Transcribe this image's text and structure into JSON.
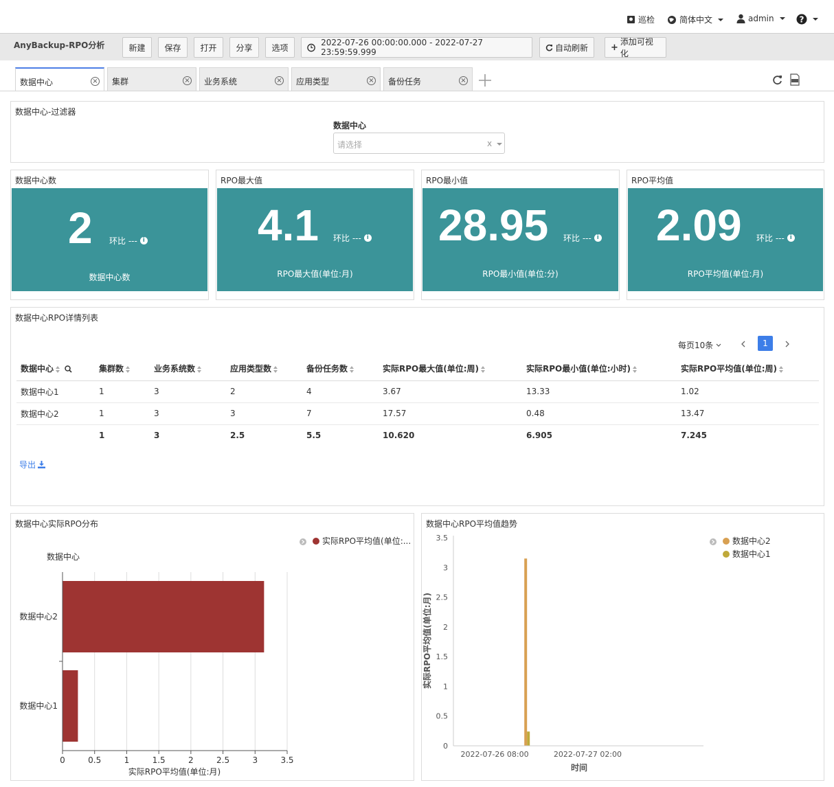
{
  "topbar": {
    "inspect_label": "巡检",
    "language_label": "简体中文",
    "user_label": "admin"
  },
  "toolbar": {
    "app_title": "AnyBackup-RPO分析",
    "new_label": "新建",
    "save_label": "保存",
    "open_label": "打开",
    "share_label": "分享",
    "options_label": "选项",
    "time_range": "2022-07-26 00:00:00.000 - 2022-07-27 23:59:59.999",
    "auto_refresh_label": "自动刷新",
    "add_visual_label": "添加可视化"
  },
  "tabs": [
    {
      "label": "数据中心"
    },
    {
      "label": "集群"
    },
    {
      "label": "业务系统"
    },
    {
      "label": "应用类型"
    },
    {
      "label": "备份任务"
    }
  ],
  "filter": {
    "title": "数据中心-过滤器",
    "field_label": "数据中心",
    "placeholder": "请选择",
    "clear": "x"
  },
  "stats": [
    {
      "title": "数据中心数",
      "value": "2",
      "ratio": "环比 ---",
      "label": "数据中心数"
    },
    {
      "title": "RPO最大值",
      "value": "4.1",
      "ratio": "环比 ---",
      "label": "RPO最大值(单位:月)"
    },
    {
      "title": "RPO最小值",
      "value": "28.95",
      "ratio": "环比 ---",
      "label": "RPO最小值(单位:分)"
    },
    {
      "title": "RPO平均值",
      "value": "2.09",
      "ratio": "环比 ---",
      "label": "RPO平均值(单位:月)"
    }
  ],
  "table": {
    "title": "数据中心RPO详情列表",
    "page_size_label": "每页10条",
    "current_page": "1",
    "headers": [
      "数据中心",
      "集群数",
      "业务系统数",
      "应用类型数",
      "备份任务数",
      "实际RPO最大值(单位:周)",
      "实际RPO最小值(单位:小时)",
      "实际RPO平均值(单位:周)"
    ],
    "rows": [
      [
        "数据中心1",
        "1",
        "3",
        "2",
        "4",
        "3.67",
        "13.33",
        "1.02"
      ],
      [
        "数据中心2",
        "1",
        "3",
        "3",
        "7",
        "17.57",
        "0.48",
        "13.47"
      ],
      [
        "",
        "1",
        "3",
        "2.5",
        "5.5",
        "10.620",
        "6.905",
        "7.245"
      ]
    ],
    "export_label": "导出"
  },
  "bar_panel": {
    "title": "数据中心实际RPO分布",
    "legend": "实际RPO平均值(单位:...",
    "ylabel": "数据中心",
    "xlabel": "实际RPO平均值(单位:月)",
    "colors": {
      "bar": "#9e3432"
    }
  },
  "trend_panel": {
    "title": "数据中心RPO平均值趋势",
    "ylabel": "实际RPO平均值(单位:月)",
    "xlabel": "时间",
    "colors": {
      "dc2": "#d8a052",
      "dc1": "#bfa93a"
    }
  },
  "chart_data": [
    {
      "type": "bar",
      "orientation": "horizontal",
      "categories": [
        "数据中心2",
        "数据中心1"
      ],
      "series": [
        {
          "name": "实际RPO平均值(单位:...",
          "values": [
            3.14,
            0.24
          ]
        }
      ],
      "xlabel": "实际RPO平均值(单位:月)",
      "ylabel": "数据中心",
      "xlim": [
        0,
        3.5
      ],
      "xticks": [
        "0",
        "0.5",
        "1",
        "1.5",
        "2",
        "2.5",
        "3",
        "3.5"
      ],
      "grid": true,
      "legend": "top-right"
    },
    {
      "type": "bar",
      "x_ticks": [
        "2022-07-26 08:00",
        "2022-07-27 02:00"
      ],
      "series": [
        {
          "name": "数据中心2",
          "x": "2022-07-26 14:00",
          "value": 3.15
        },
        {
          "name": "数据中心1",
          "x": "2022-07-26 14:00",
          "value": 0.24
        }
      ],
      "xlabel": "时间",
      "ylabel": "实际RPO平均值(单位:月)",
      "ylim": [
        0,
        3.5
      ],
      "yticks": [
        "0",
        "0.5",
        "1",
        "1.5",
        "2",
        "2.5",
        "3",
        "3.5"
      ],
      "legend": "top-right"
    }
  ]
}
